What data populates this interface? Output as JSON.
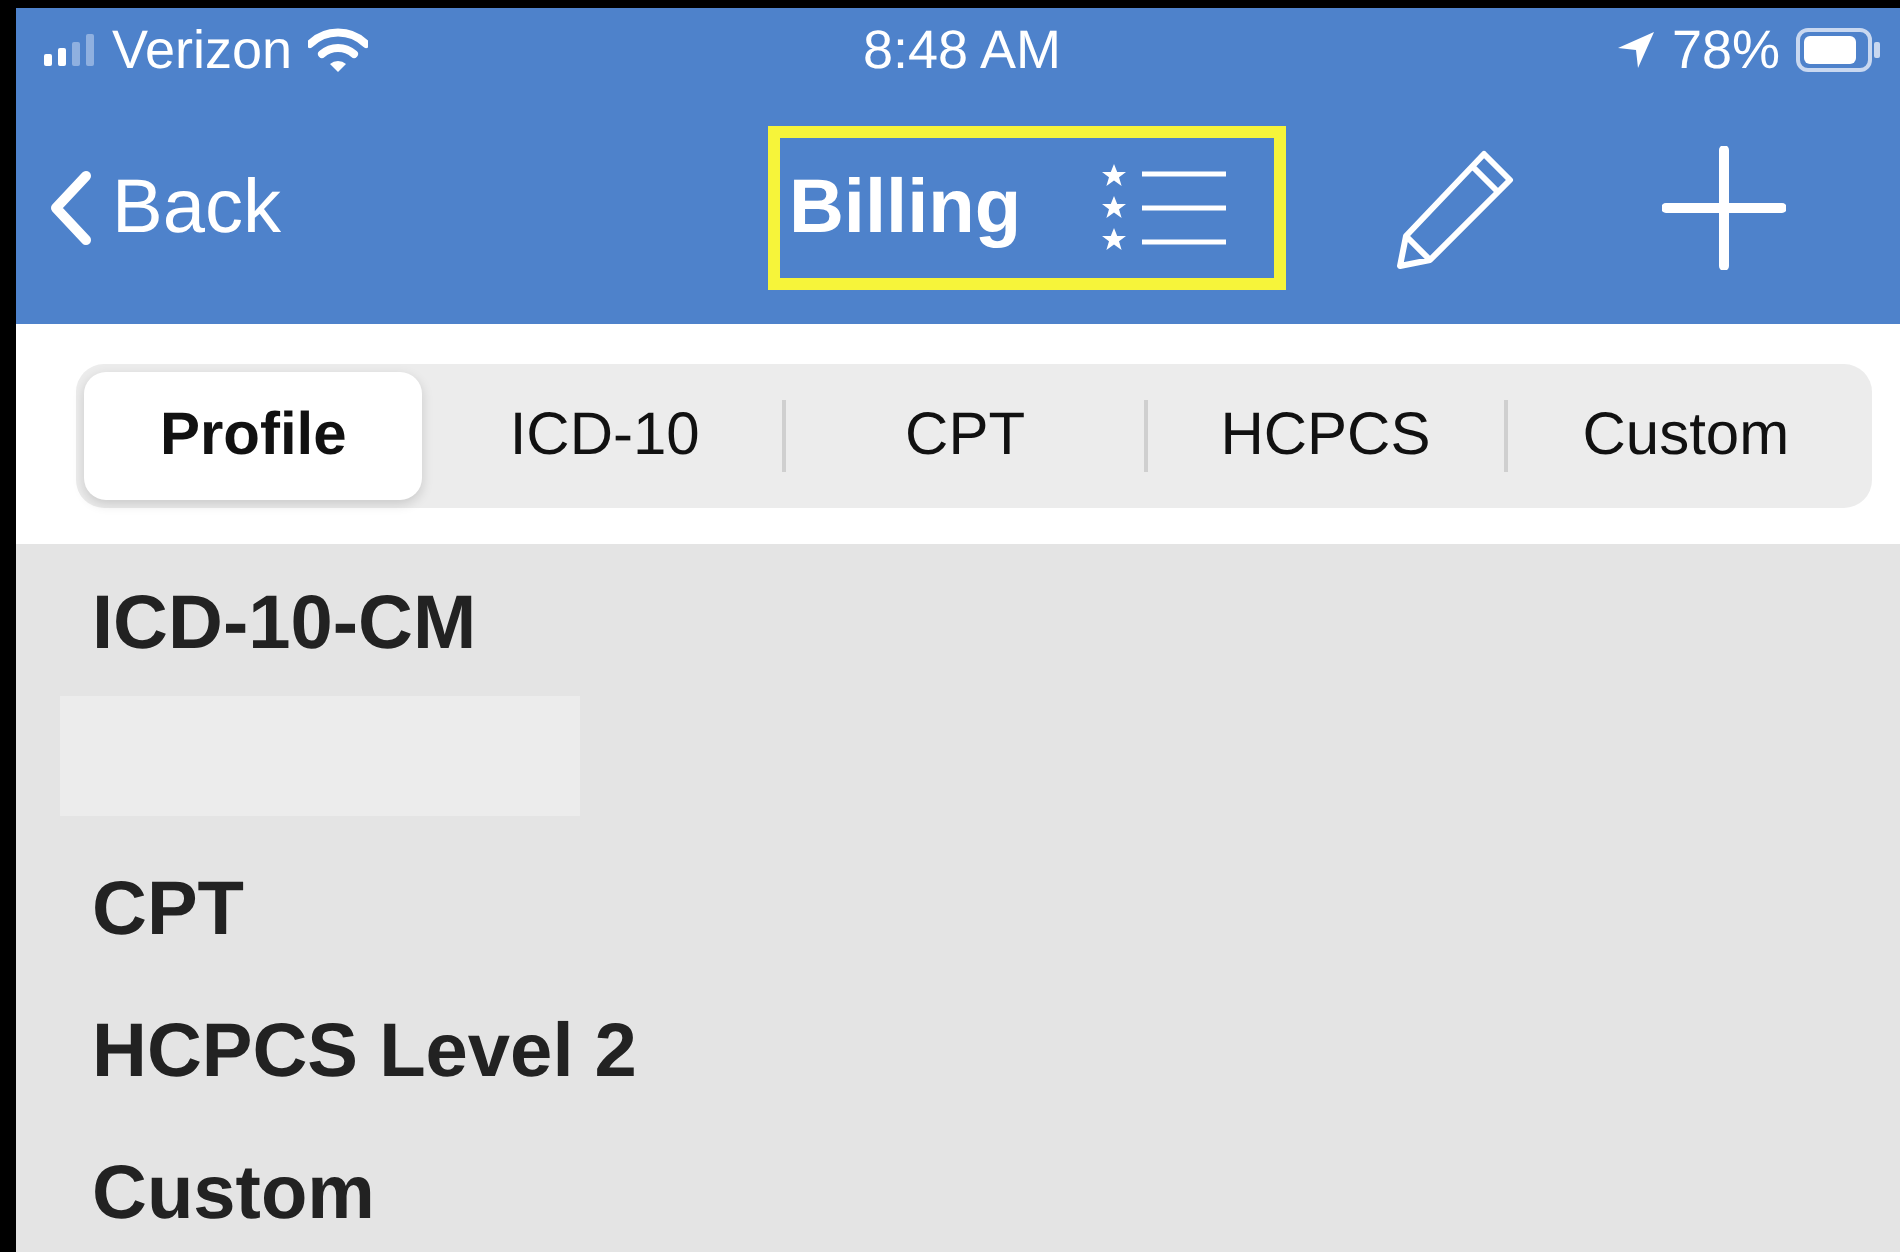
{
  "status_bar": {
    "carrier": "Verizon",
    "time": "8:48 AM",
    "battery": "78%"
  },
  "nav_bar": {
    "back": "Back",
    "title": "Billing",
    "title_highlighted": true
  },
  "segments": [
    {
      "label": "Profile",
      "selected": true
    },
    {
      "label": "ICD-10",
      "selected": false
    },
    {
      "label": "CPT",
      "selected": false
    },
    {
      "label": "HCPCS",
      "selected": false
    },
    {
      "label": "Custom",
      "selected": false
    }
  ],
  "list": [
    {
      "kind": "heading",
      "label": "ICD-10-CM"
    },
    {
      "kind": "blank"
    },
    {
      "kind": "heading",
      "label": "CPT"
    },
    {
      "kind": "heading",
      "label": "HCPCS Level 2"
    },
    {
      "kind": "heading",
      "label": "Custom"
    }
  ]
}
